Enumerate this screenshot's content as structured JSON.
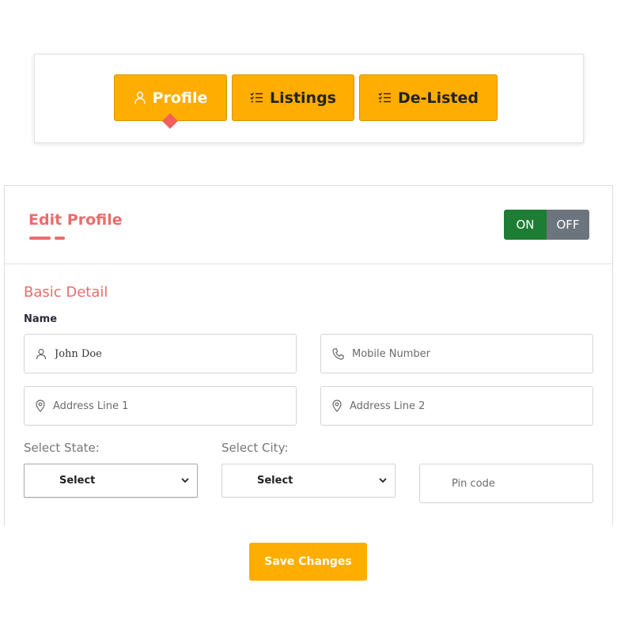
{
  "tabs": {
    "profile": {
      "label": "Profile",
      "icon": "user-icon"
    },
    "listings": {
      "label": "Listings",
      "icon": "list-icon"
    },
    "delisted": {
      "label": "De-Listed",
      "icon": "list-icon"
    }
  },
  "active_tab": "profile",
  "card": {
    "title": "Edit Profile",
    "toggle": {
      "on_label": "ON",
      "off_label": "OFF",
      "state": "on"
    }
  },
  "basic_detail": {
    "section_title": "Basic Detail",
    "name_label": "Name",
    "name": {
      "value": "John Doe",
      "icon": "user-icon"
    },
    "mobile": {
      "placeholder": "Mobile Number",
      "icon": "phone-icon"
    },
    "address1": {
      "placeholder": "Address Line 1",
      "icon": "location-pin-icon"
    },
    "address2": {
      "placeholder": "Address Line 2",
      "icon": "location-pin-icon"
    },
    "state_label": "Select State:",
    "state_value": "Select",
    "city_label": "Select City:",
    "city_value": "Select",
    "pincode": {
      "placeholder": "Pin code"
    }
  },
  "save_label": "Save Changes",
  "colors": {
    "accent": "#ffad00",
    "heading": "#ed6b6b",
    "toggle_on": "#1e7d34",
    "toggle_off": "#6c757d"
  }
}
